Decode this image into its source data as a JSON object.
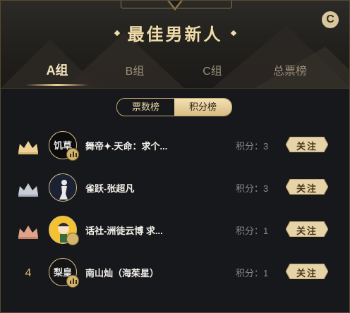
{
  "header": {
    "title": "最佳男新人",
    "refresh_icon_text": "C"
  },
  "tabs": [
    {
      "label": "A组",
      "active": true
    },
    {
      "label": "B组",
      "active": false
    },
    {
      "label": "C组",
      "active": false
    },
    {
      "label": "总票榜",
      "active": false
    }
  ],
  "segment": {
    "options": [
      {
        "label": "票数榜",
        "active": false
      },
      {
        "label": "积分榜",
        "active": true
      }
    ]
  },
  "ranking": [
    {
      "rank": "1",
      "rank_icon": "gold-crown-icon",
      "avatar_text": "饥草",
      "name": "舞帝✦.天命：求个...",
      "score": "积分：3",
      "follow": "关注"
    },
    {
      "rank": "2",
      "rank_icon": "silver-crown-icon",
      "avatar_text": "",
      "name": "雀跃-张超凡",
      "score": "积分：3",
      "follow": "关注"
    },
    {
      "rank": "3",
      "rank_icon": "bronze-crown-icon",
      "avatar_text": "",
      "name": "话社-洲徒云博 求...",
      "score": "积分：1",
      "follow": "关注"
    },
    {
      "rank": "4",
      "rank_icon": "",
      "avatar_text": "梨皇",
      "name": "南山灿（海茱星）",
      "score": "积分：1",
      "follow": "关注"
    }
  ],
  "colors": {
    "gold": "#f0d296",
    "silver": "#c7cdd6",
    "bronze": "#e0a38a",
    "button": "#e6d3a8"
  }
}
